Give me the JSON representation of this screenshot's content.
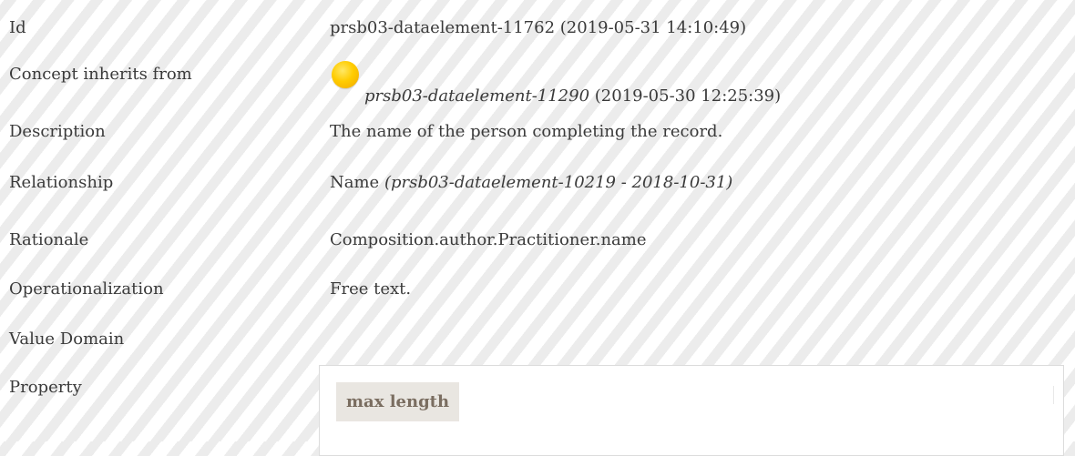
{
  "rows": [
    {
      "label": "Id",
      "value": "prsb03-dataelement-11762 (2019-05-31 14:10:49)"
    },
    {
      "label": "Concept inherits from",
      "value_link": "prsb03-dataelement-11290",
      "value_rest": " (2019-05-30 12:25:39)",
      "icon": "status-dot-icon",
      "icon_color": "#ffcc00"
    },
    {
      "label": "Description",
      "value": "The name of the person completing the record."
    },
    {
      "label": "Relationship",
      "value": "Name ",
      "value_italic": "(prsb03-dataelement-10219 - 2018-10-31)"
    },
    {
      "label": "Rationale",
      "value": "Composition.author.Practitioner.name"
    },
    {
      "label": "Operationalization",
      "value": "Free text."
    },
    {
      "label": "Value Domain",
      "value": ""
    },
    {
      "label": "Property",
      "value": ""
    }
  ],
  "property_panel": {
    "header": "max length"
  }
}
